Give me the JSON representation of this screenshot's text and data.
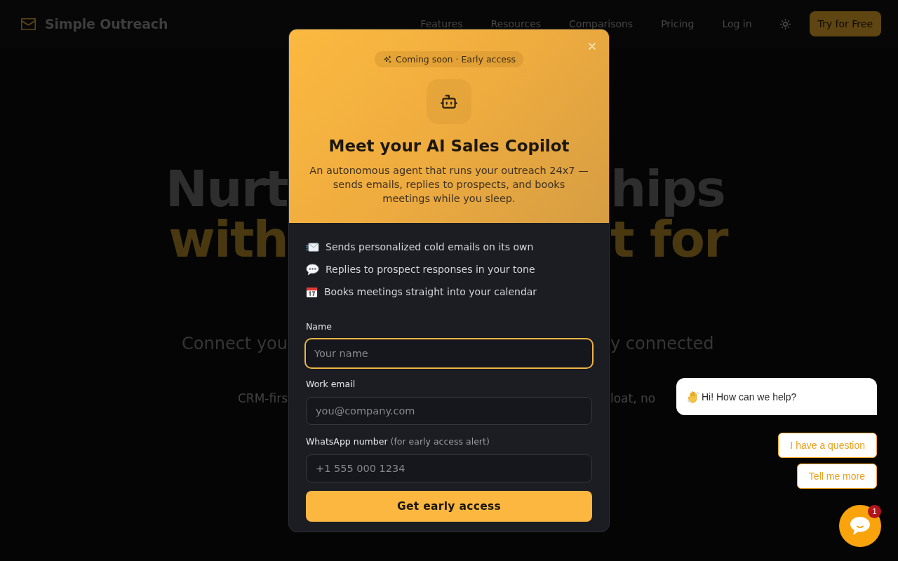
{
  "nav": {
    "brand": "Simple Outreach",
    "links": [
      "Features",
      "Resources",
      "Comparisons",
      "Pricing",
      "Log in"
    ],
    "cta": "Try for Free"
  },
  "hero": {
    "lines": [
      {
        "kind": "heading",
        "left": "Nurt",
        "right": "hips"
      },
      {
        "kind": "accent",
        "left": "with",
        "right": "t for"
      },
      {
        "kind": "subtitle",
        "left": "Connect you",
        "right": "y connected"
      },
      {
        "kind": "note",
        "left": "CRM-firs",
        "right": "loat, no"
      }
    ]
  },
  "modal": {
    "badge": "Coming soon · Early access",
    "title": "Meet your AI Sales Copilot",
    "description": "An autonomous agent that runs your outreach 24x7 — sends emails, replies to prospects, and books meetings while you sleep.",
    "features": [
      {
        "kind": "envelope",
        "text": "Sends personalized cold emails on its own"
      },
      {
        "kind": "chat",
        "text": "Replies to prospect responses in your tone"
      },
      {
        "kind": "calendar",
        "text": "Books meetings straight into your calendar"
      }
    ],
    "fields": [
      {
        "label": "Name",
        "placeholder": "Your name",
        "focused": true
      },
      {
        "label": "Work email",
        "placeholder": "you@company.com",
        "focused": false
      },
      {
        "label": "WhatsApp number",
        "hint": "(for early access alert)",
        "placeholder": "+1 555 000 1234",
        "focused": false
      }
    ],
    "submit": "Get early access"
  },
  "chat": {
    "greeting": "Hi! How can we help?",
    "replies": [
      "I have a question",
      "Tell me more"
    ],
    "unread": "1"
  }
}
